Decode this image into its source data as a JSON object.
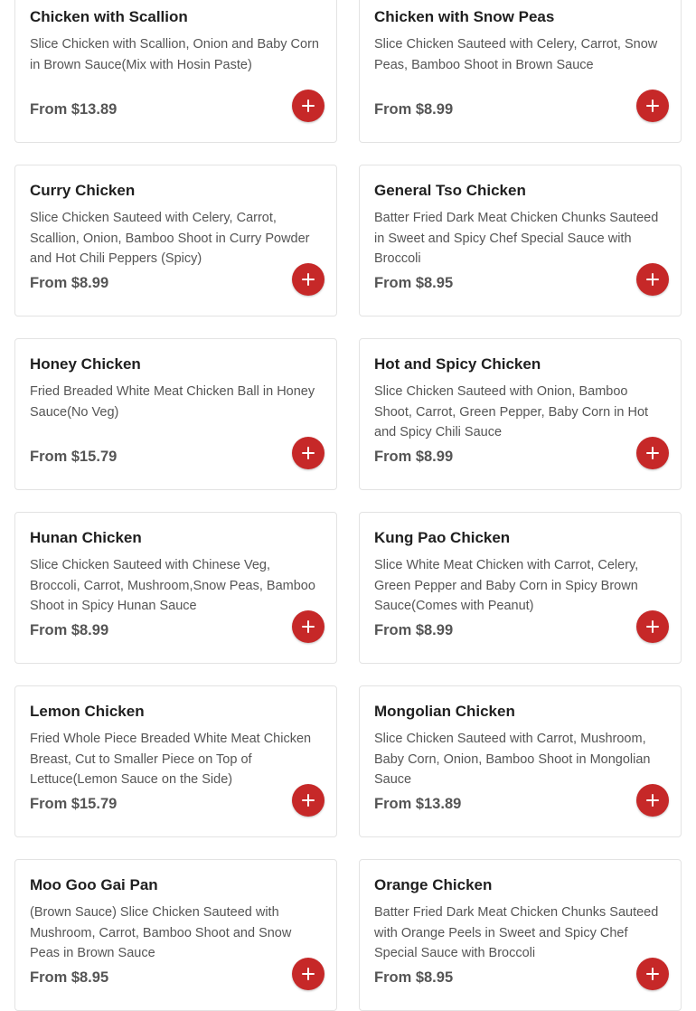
{
  "menu": {
    "items": [
      {
        "name": "Chicken with Scallion",
        "description": "Slice Chicken with Scallion, Onion and Baby Corn in Brown Sauce(Mix with Hosin Paste)",
        "price": "From $13.89",
        "add_icon": "plus-icon"
      },
      {
        "name": "Chicken with Snow Peas",
        "description": "Slice Chicken Sauteed with Celery, Carrot, Snow Peas, Bamboo Shoot in Brown Sauce",
        "price": "From $8.99",
        "add_icon": "plus-icon"
      },
      {
        "name": "Curry Chicken",
        "description": "Slice Chicken Sauteed with Celery, Carrot, Scallion, Onion, Bamboo Shoot in Curry Powder and Hot Chili Peppers (Spicy)",
        "price": "From $8.99",
        "add_icon": "plus-icon"
      },
      {
        "name": "General Tso Chicken",
        "description": "Batter Fried Dark Meat Chicken Chunks Sauteed in Sweet and Spicy Chef Special Sauce with Broccoli",
        "price": "From $8.95",
        "add_icon": "plus-icon"
      },
      {
        "name": "Honey Chicken",
        "description": "Fried Breaded White Meat Chicken Ball in Honey Sauce(No Veg)",
        "price": "From $15.79",
        "add_icon": "plus-icon"
      },
      {
        "name": "Hot and Spicy Chicken",
        "description": "Slice Chicken Sauteed with Onion, Bamboo Shoot, Carrot, Green Pepper, Baby Corn in Hot and Spicy Chili Sauce",
        "price": "From $8.99",
        "add_icon": "plus-icon"
      },
      {
        "name": "Hunan Chicken",
        "description": "Slice Chicken Sauteed with Chinese Veg, Broccoli, Carrot, Mushroom,Snow Peas, Bamboo Shoot in Spicy Hunan Sauce",
        "price": "From $8.99",
        "add_icon": "plus-icon"
      },
      {
        "name": "Kung Pao Chicken",
        "description": "Slice White Meat Chicken with Carrot, Celery, Green Pepper and Baby Corn in Spicy Brown Sauce(Comes with Peanut)",
        "price": "From $8.99",
        "add_icon": "plus-icon"
      },
      {
        "name": "Lemon Chicken",
        "description": "Fried Whole Piece Breaded White Meat Chicken Breast, Cut to Smaller Piece on Top of Lettuce(Lemon Sauce on the Side)",
        "price": "From $15.79",
        "add_icon": "plus-icon"
      },
      {
        "name": "Mongolian Chicken",
        "description": "Slice Chicken Sauteed with Carrot, Mushroom, Baby Corn, Onion, Bamboo Shoot in Mongolian Sauce",
        "price": "From $13.89",
        "add_icon": "plus-icon"
      },
      {
        "name": "Moo Goo Gai Pan",
        "description": "(Brown Sauce) Slice Chicken Sauteed with Mushroom, Carrot, Bamboo Shoot and Snow Peas in Brown Sauce",
        "price": "From $8.95",
        "add_icon": "plus-icon"
      },
      {
        "name": "Orange Chicken",
        "description": "Batter Fried Dark Meat Chicken Chunks Sauteed with Orange Peels in Sweet and Spicy Chef Special Sauce with Broccoli",
        "price": "From $8.95",
        "add_icon": "plus-icon"
      }
    ]
  },
  "colors": {
    "accent": "#c62828",
    "card_border": "#e3e3e3",
    "text_primary": "#1f1f1f",
    "text_secondary": "#555555"
  }
}
